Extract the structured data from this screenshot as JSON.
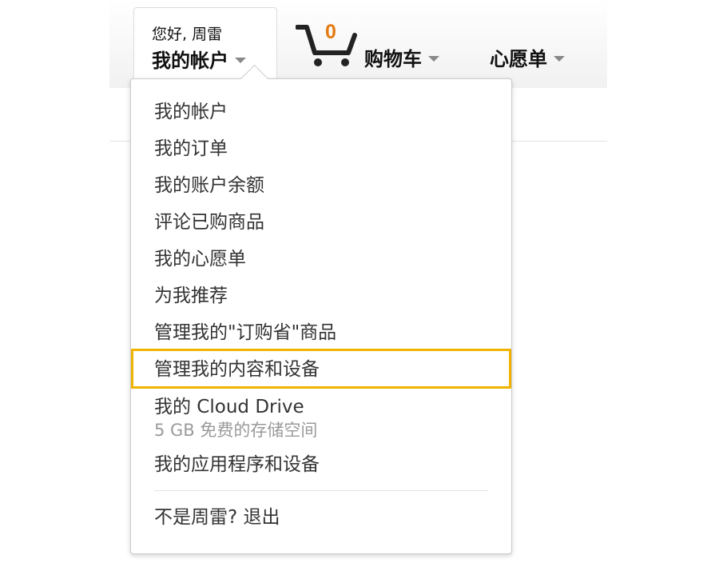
{
  "nav": {
    "account": {
      "greeting": "您好, 周雷",
      "label": "我的帐户"
    },
    "cart": {
      "count": "0",
      "label": "购物车",
      "icon": "cart-icon",
      "count_color": "#e47911"
    },
    "wishlist": {
      "label": "心愿单"
    }
  },
  "dropdown": {
    "items": [
      {
        "label": "我的帐户"
      },
      {
        "label": "我的订单"
      },
      {
        "label": "我的账户余额"
      },
      {
        "label": "评论已购商品"
      },
      {
        "label": "我的心愿单"
      },
      {
        "label": "为我推荐"
      },
      {
        "label": "管理我的\"订购省\"商品"
      },
      {
        "label": "管理我的内容和设备",
        "highlighted": true
      },
      {
        "label": "我的 Cloud Drive",
        "sublabel": "5 GB 免费的存储空间"
      },
      {
        "label": "我的应用程序和设备"
      }
    ],
    "signout": "不是周雷?  退出",
    "highlight_color": "#f0b400"
  }
}
